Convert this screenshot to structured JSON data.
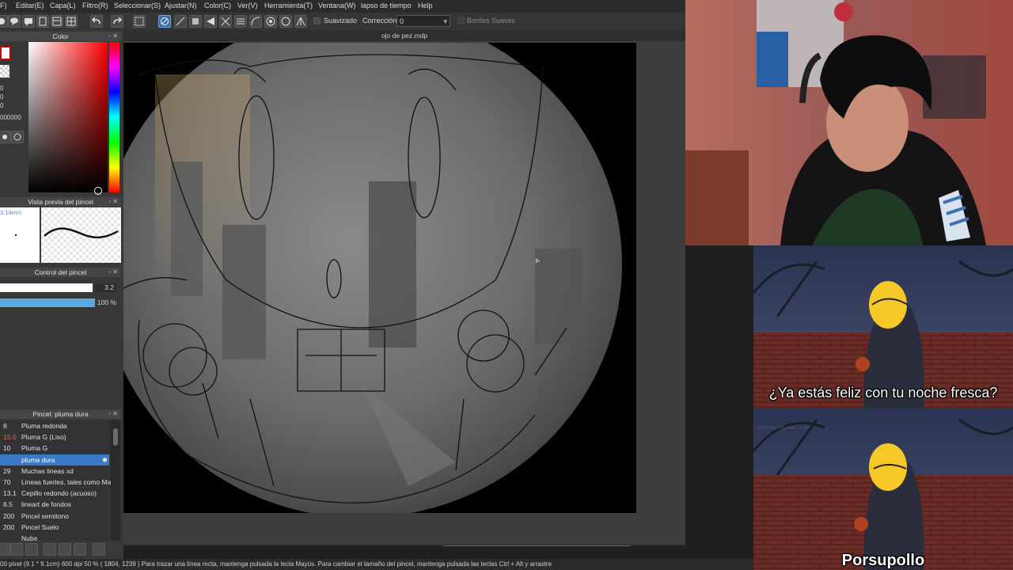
{
  "menu": [
    "F)",
    "Editar(E)",
    "Capa(L)",
    "Filtro(R)",
    "Seleccionar(S)",
    "Ajustar(N)",
    "Color(C)",
    "Ver(V)",
    "Herramienta(T)",
    "Ventana(W)",
    "lapso de tiempo",
    "Help"
  ],
  "toolbar": {
    "smoothing_label": "Suavizado",
    "correction_label": "Corrección",
    "correction_value": "0",
    "soft_edges_label": "Bordes Suaves"
  },
  "color_panel": {
    "title": "Color",
    "readouts": [
      "0",
      "0",
      "0",
      "000000"
    ]
  },
  "brush_preview": {
    "title": "Vista previa del pincel",
    "size_text": "3.14mm"
  },
  "brush_control": {
    "title": "Control del pincel",
    "size_value": "3.2",
    "opacity_value": "100 %"
  },
  "brush_list": {
    "title": "Pincel: pluma dura",
    "items": [
      {
        "size": "8",
        "name": "Pluma redonda",
        "size_color": "#e0e0e0"
      },
      {
        "size": "15.0",
        "name": "Pluma G (Liso)",
        "size_color": "#e06666"
      },
      {
        "size": "10",
        "name": "Pluma G",
        "size_color": "#e0e0e0"
      },
      {
        "size": "",
        "name": "pluma dura",
        "size_color": "#ffffff"
      },
      {
        "size": "29",
        "name": "Muchas lineas xd",
        "size_color": "#e0e0e0"
      },
      {
        "size": "70",
        "name": "Lineas fuertes, tales como Ma",
        "size_color": "#e0e0e0"
      },
      {
        "size": "13.1",
        "name": "Cepillo redondo (acuoso)",
        "size_color": "#e0e0e0"
      },
      {
        "size": "6.5",
        "name": "lineart de fondos",
        "size_color": "#e0e0e0"
      },
      {
        "size": "200",
        "name": "Pincel semitono",
        "size_color": "#e0e0e0"
      },
      {
        "size": "200",
        "name": "Pincel Suelo",
        "size_color": "#e0e0e0"
      },
      {
        "size": "",
        "name": "Nube",
        "size_color": "#e0e0e0"
      }
    ],
    "selected_index": 3
  },
  "document": {
    "title": "ojo de pez.mdp"
  },
  "status": {
    "text": "00 pixel  (9.1 * 9.1cm)  600 dpi   50 %  ( 1804, 1239 )  Para trazar una línea recta, mantenga pulsada la tecla Mayús. Para cambiar el tamaño del pincel, mantenga pulsada las teclas Ctrl + Alt y arrastre"
  },
  "meme": {
    "caption_top": "¿Ya estás feliz con tu noche fresca?",
    "caption_bottom": "Porsupollo",
    "watermark": "COSMIC PILAMETO SP"
  },
  "colors": {
    "accent": "#3a78c8",
    "panel_bg": "#3a3a3a",
    "menubar_bg": "#2b2b2b"
  }
}
